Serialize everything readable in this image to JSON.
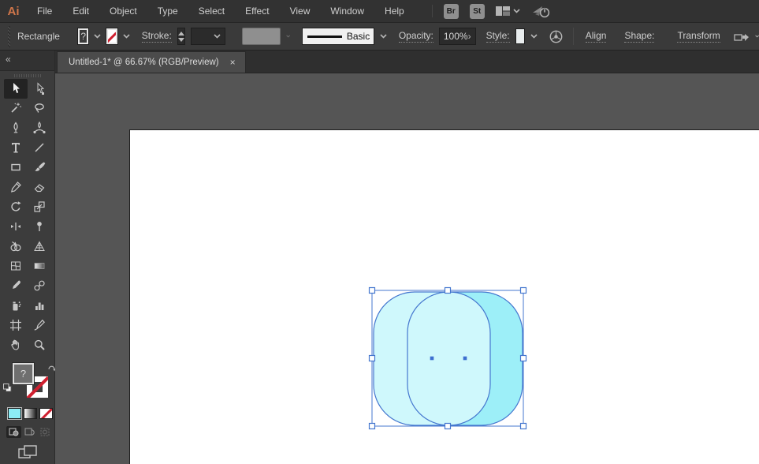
{
  "menubar": {
    "logo": "Ai",
    "items": [
      "File",
      "Edit",
      "Object",
      "Type",
      "Select",
      "Effect",
      "View",
      "Window",
      "Help"
    ],
    "bridge_label": "Br",
    "stock_label": "St",
    "icons": [
      "workspace-switcher-icon",
      "share-publish-icon"
    ]
  },
  "options": {
    "tool_context": "Rectangle",
    "fill_value": "?",
    "stroke_label": "Stroke:",
    "stroke_weight_value": "",
    "brush_definition": "Basic",
    "opacity_label": "Opacity:",
    "opacity_value": "100%",
    "opacity_arrow": "›",
    "style_label": "Style:",
    "align_label": "Align",
    "shape_label": "Shape:",
    "transform_label": "Transform",
    "icons": [
      "fill-swatch",
      "stroke-none-swatch",
      "recolor-artwork-icon",
      "arrange-icon"
    ]
  },
  "tabstrip": {
    "collapse_glyph": "«",
    "tabs": [
      {
        "title": "Untitled-1* @ 66.67% (RGB/Preview)",
        "close_glyph": "×",
        "active": true
      }
    ]
  },
  "toolbar": {
    "tools": [
      "selection",
      "direct-selection",
      "magic-wand",
      "lasso",
      "pen",
      "curvature",
      "type",
      "line-segment",
      "rectangle",
      "paintbrush",
      "shaper",
      "eraser",
      "rotate",
      "scale",
      "width",
      "puppet-warp",
      "shape-builder",
      "perspective-grid",
      "mesh",
      "gradient",
      "eyedropper",
      "blend",
      "symbol-sprayer",
      "column-graph",
      "artboard",
      "slice",
      "hand",
      "zoom"
    ],
    "active_tool": "selection",
    "fill_indicator_value": "?",
    "color_button_color": "#8cecf5",
    "draw_modes": [
      "draw-normal",
      "draw-behind",
      "draw-inside"
    ],
    "active_draw_mode": "draw-normal"
  },
  "canvas": {
    "artboard_color": "#ffffff",
    "pasteboard_color": "#555555",
    "selection": {
      "outline_color": "#4577cf",
      "handle_fill": "#ffffff",
      "back_shape_fill": "#9deff8",
      "front_shape_fill": "#cff8fc",
      "center_dot_color": "#3d6fd0"
    }
  }
}
